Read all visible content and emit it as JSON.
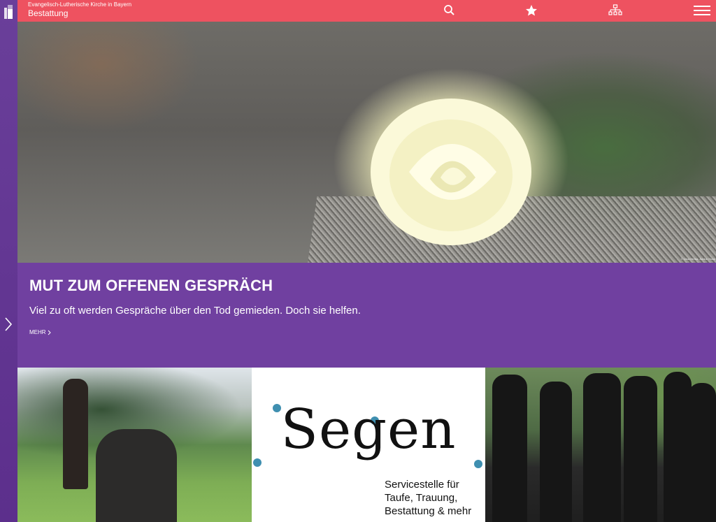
{
  "header": {
    "org_name": "Evangelisch-Lutherische Kirche in Bayern",
    "section_title": "Bestattung",
    "icons": [
      "search-icon",
      "star-icon",
      "sitemap-icon",
      "menu-icon"
    ]
  },
  "colors": {
    "topbar": "#ee5260",
    "side_rail": "#5c2f8c",
    "teaser_bg": "#7040a0",
    "segen_dot": "#3f8fb0"
  },
  "hero": {
    "credit": "© Nina Mehta, Adobe Stock"
  },
  "teaser": {
    "title": "MUT ZUM OFFENEN GESPRÄCH",
    "text": "Viel zu oft werden Gespräche über den Tod gemieden. Doch sie helfen.",
    "more_label": "MEHR"
  },
  "tiles": {
    "segen_word": "Segen",
    "segen_lines": [
      "Servicestelle für",
      "Taufe, Trauung,",
      "Bestattung & mehr"
    ]
  }
}
